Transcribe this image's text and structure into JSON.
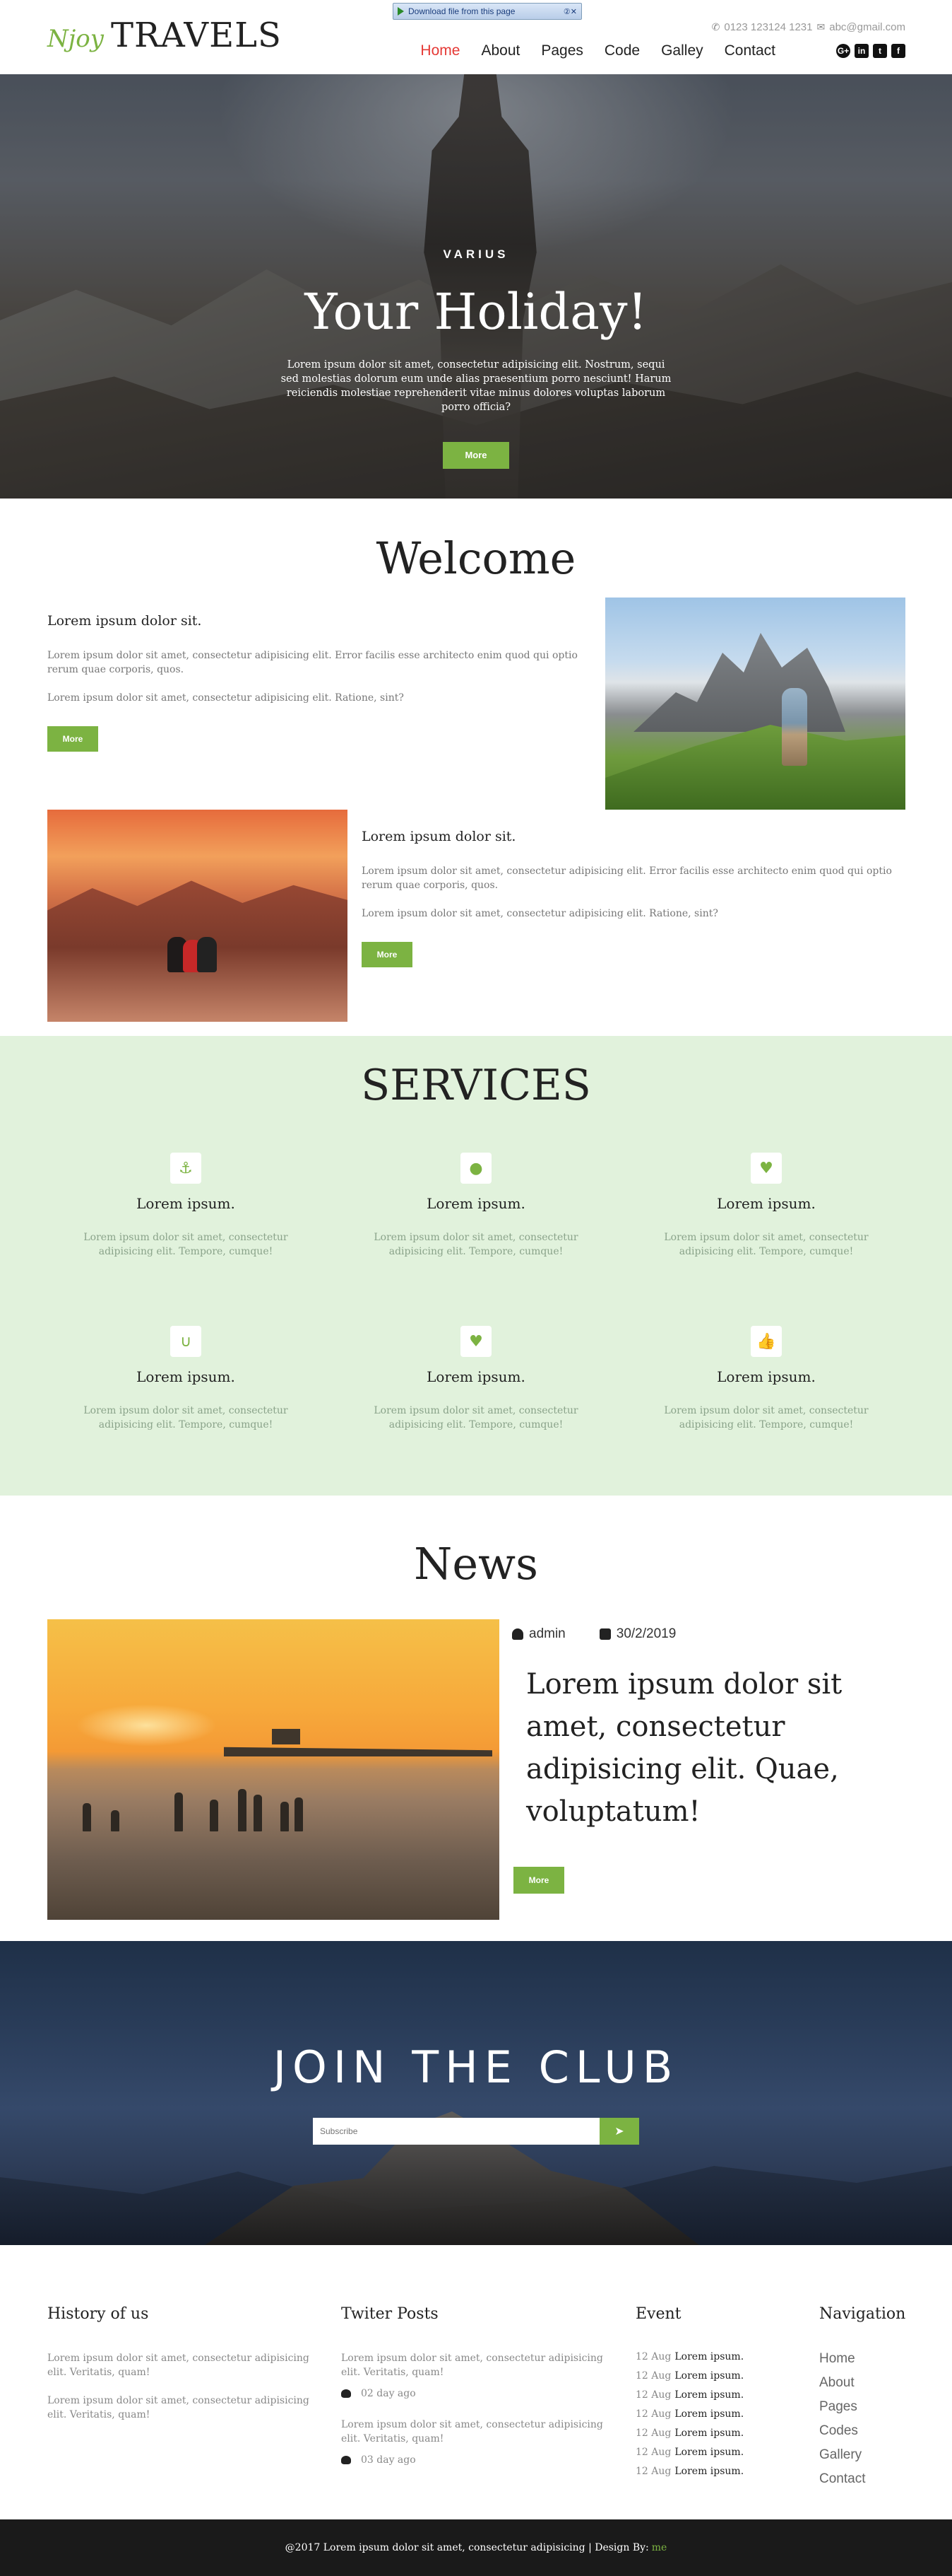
{
  "download_bar": {
    "label": "Download file from this page"
  },
  "brand": {
    "prefix": "Njoy",
    "name": "TRAVELS"
  },
  "contact": {
    "phone": "0123 123124 1231",
    "email": "abc@gmail.com"
  },
  "nav": [
    {
      "label": "Home",
      "active": true
    },
    {
      "label": "About"
    },
    {
      "label": "Pages"
    },
    {
      "label": "Code"
    },
    {
      "label": "Galley"
    },
    {
      "label": "Contact"
    }
  ],
  "social": [
    "G+",
    "in",
    "t",
    "f"
  ],
  "hero": {
    "kicker": "VARIUS",
    "title": "Your Holiday!",
    "text": "Lorem ipsum dolor sit amet, consectetur adipisicing elit. Nostrum, sequi sed molestias dolorum eum unde alias praesentium porro nesciunt! Harum reiciendis molestiae reprehenderit vitae minus dolores voluptas laborum porro officia?",
    "button": "More"
  },
  "welcome": {
    "title": "Welcome",
    "blocks": [
      {
        "heading": "Lorem ipsum dolor sit.",
        "p1": "Lorem ipsum dolor sit amet, consectetur adipisicing elit. Error facilis esse architecto enim quod qui optio rerum quae corporis, quos.",
        "p2": "Lorem ipsum dolor sit amet, consectetur adipisicing elit. Ratione, sint?",
        "button": "More"
      },
      {
        "heading": "Lorem ipsum dolor sit.",
        "p1": "Lorem ipsum dolor sit amet, consectetur adipisicing elit. Error facilis esse architecto enim quod qui optio rerum quae corporis, quos.",
        "p2": "Lorem ipsum dolor sit amet, consectetur adipisicing elit. Ratione, sint?",
        "button": "More"
      }
    ]
  },
  "services": {
    "title": "SERVICES",
    "items": [
      {
        "icon": "anchor-icon",
        "glyph": "⚓",
        "title": "Lorem ipsum.",
        "text": "Lorem ipsum dolor sit amet, consectetur adipisicing elit. Tempore, cumque!"
      },
      {
        "icon": "comment-icon",
        "glyph": "●",
        "title": "Lorem ipsum.",
        "text": "Lorem ipsum dolor sit amet, consectetur adipisicing elit. Tempore, cumque!"
      },
      {
        "icon": "heartbeat-icon",
        "glyph": "♥",
        "title": "Lorem ipsum.",
        "text": "Lorem ipsum dolor sit amet, consectetur adipisicing elit. Tempore, cumque!"
      },
      {
        "icon": "magnet-icon",
        "glyph": "∪",
        "title": "Lorem ipsum.",
        "text": "Lorem ipsum dolor sit amet, consectetur adipisicing elit. Tempore, cumque!"
      },
      {
        "icon": "heartbeat-icon",
        "glyph": "♥",
        "title": "Lorem ipsum.",
        "text": "Lorem ipsum dolor sit amet, consectetur adipisicing elit. Tempore, cumque!"
      },
      {
        "icon": "thumbs-up-icon",
        "glyph": "👍",
        "title": "Lorem ipsum.",
        "text": "Lorem ipsum dolor sit amet, consectetur adipisicing elit. Tempore, cumque!"
      }
    ]
  },
  "news": {
    "title": "News",
    "author": "admin",
    "date": "30/2/2019",
    "headline": "Lorem ipsum dolor sit amet, consectetur adipisicing elit. Quae, voluptatum!",
    "button": "More"
  },
  "join": {
    "title": "JOIN THE CLUB",
    "placeholder": "Subscribe",
    "submit_icon": "send-icon"
  },
  "footer": {
    "history": {
      "title": "History of us",
      "p1": "Lorem ipsum dolor sit amet, consectetur adipisicing elit. Veritatis, quam!",
      "p2": "Lorem ipsum dolor sit amet, consectetur adipisicing elit. Veritatis, quam!"
    },
    "twitter": {
      "title": "Twiter Posts",
      "posts": [
        {
          "text": "Lorem ipsum dolor sit amet, consectetur adipisicing elit. Veritatis, quam!",
          "time": "02 day ago"
        },
        {
          "text": "Lorem ipsum dolor sit amet, consectetur adipisicing elit. Veritatis, quam!",
          "time": "03 day ago"
        }
      ]
    },
    "event": {
      "title": "Event",
      "items": [
        {
          "date": "12 Aug",
          "title": "Lorem ipsum."
        },
        {
          "date": "12 Aug",
          "title": "Lorem ipsum."
        },
        {
          "date": "12 Aug",
          "title": "Lorem ipsum."
        },
        {
          "date": "12 Aug",
          "title": "Lorem ipsum."
        },
        {
          "date": "12 Aug",
          "title": "Lorem ipsum."
        },
        {
          "date": "12 Aug",
          "title": "Lorem ipsum."
        },
        {
          "date": "12 Aug",
          "title": "Lorem ipsum."
        }
      ]
    },
    "navigation": {
      "title": "Navigation",
      "links": [
        "Home",
        "About",
        "Pages",
        "Codes",
        "Gallery",
        "Contact"
      ]
    }
  },
  "copyright": {
    "text": "@2017 Lorem ipsum dolor sit amet, consectetur adipisicing | Design By:",
    "author": "me"
  },
  "colors": {
    "accent": "#7cb342",
    "active_nav": "#e53935",
    "services_bg": "#e1f2dc",
    "footer_bar": "#1a1a1a"
  }
}
